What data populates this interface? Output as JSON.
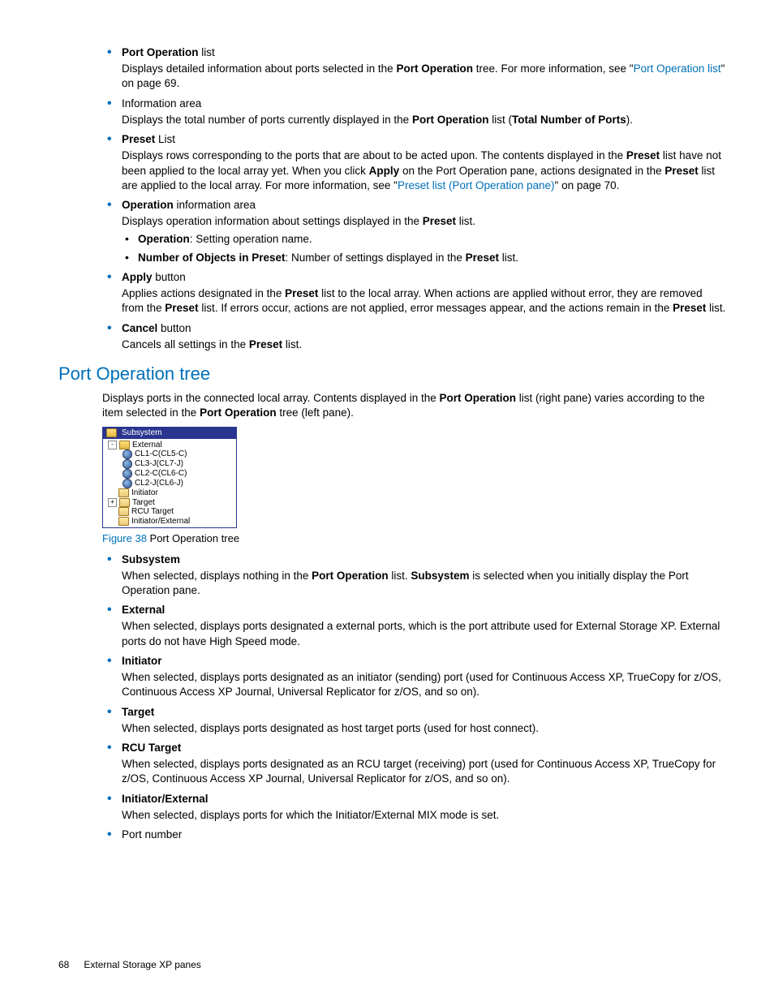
{
  "top_bullets": [
    {
      "title_segments": [
        {
          "t": "Port Operation",
          "b": true
        },
        {
          "t": " list",
          "b": false
        }
      ],
      "body_segments": [
        {
          "t": "Displays detailed information about ports selected in the ",
          "b": false
        },
        {
          "t": "Port Operation",
          "b": true
        },
        {
          "t": " tree. For more information, see \"",
          "b": false
        },
        {
          "t": "Port Operation list",
          "link": true
        },
        {
          "t": "\" on page 69.",
          "b": false
        }
      ]
    },
    {
      "title_segments": [
        {
          "t": "Information area",
          "b": false
        }
      ],
      "body_segments": [
        {
          "t": "Displays the total number of ports currently displayed in the ",
          "b": false
        },
        {
          "t": "Port Operation",
          "b": true
        },
        {
          "t": " list (",
          "b": false
        },
        {
          "t": "Total Number of Ports",
          "b": true
        },
        {
          "t": ").",
          "b": false
        }
      ]
    },
    {
      "title_segments": [
        {
          "t": "Preset",
          "b": true
        },
        {
          "t": " List",
          "b": false
        }
      ],
      "body_segments": [
        {
          "t": "Displays rows corresponding to the ports that are about to be acted upon. The contents displayed in the ",
          "b": false
        },
        {
          "t": "Preset",
          "b": true
        },
        {
          "t": " list have not been applied to the local array yet. When you click ",
          "b": false
        },
        {
          "t": "Apply",
          "b": true
        },
        {
          "t": " on the Port Operation pane, actions designated in the ",
          "b": false
        },
        {
          "t": "Preset",
          "b": true
        },
        {
          "t": " list are applied to the local array. For more information, see \"",
          "b": false
        },
        {
          "t": "Preset list (Port Operation pane)",
          "link": true
        },
        {
          "t": "\" on page 70.",
          "b": false
        }
      ]
    },
    {
      "title_segments": [
        {
          "t": "Operation",
          "b": true
        },
        {
          "t": " information area",
          "b": false
        }
      ],
      "body_segments": [
        {
          "t": "Displays operation information about settings displayed in the ",
          "b": false
        },
        {
          "t": "Preset",
          "b": true
        },
        {
          "t": " list.",
          "b": false
        }
      ],
      "sub": [
        [
          {
            "t": "Operation",
            "b": true
          },
          {
            "t": ": Setting operation name.",
            "b": false
          }
        ],
        [
          {
            "t": "Number of Objects in Preset",
            "b": true
          },
          {
            "t": ": Number of settings displayed in the ",
            "b": false
          },
          {
            "t": "Preset",
            "b": true
          },
          {
            "t": " list.",
            "b": false
          }
        ]
      ]
    },
    {
      "title_segments": [
        {
          "t": "Apply",
          "b": true
        },
        {
          "t": " button",
          "b": false
        }
      ],
      "body_segments": [
        {
          "t": "Applies actions designated in the ",
          "b": false
        },
        {
          "t": "Preset",
          "b": true
        },
        {
          "t": " list to the local array. When actions are applied without error, they are removed from the ",
          "b": false
        },
        {
          "t": "Preset",
          "b": true
        },
        {
          "t": " list. If errors occur, actions are not applied, error messages appear, and the actions remain in the ",
          "b": false
        },
        {
          "t": "Preset",
          "b": true
        },
        {
          "t": " list.",
          "b": false
        }
      ]
    },
    {
      "title_segments": [
        {
          "t": "Cancel",
          "b": true
        },
        {
          "t": " button",
          "b": false
        }
      ],
      "body_segments": [
        {
          "t": "Cancels all settings in the ",
          "b": false
        },
        {
          "t": "Preset",
          "b": true
        },
        {
          "t": " list.",
          "b": false
        }
      ]
    }
  ],
  "section_heading": "Port Operation tree",
  "section_intro_segments": [
    {
      "t": "Displays ports in the connected local array. Contents displayed in the ",
      "b": false
    },
    {
      "t": "Port Operation",
      "b": true
    },
    {
      "t": " list (right pane) varies according to the item selected in the ",
      "b": false
    },
    {
      "t": "Port Operation",
      "b": true
    },
    {
      "t": " tree (left pane).",
      "b": false
    }
  ],
  "figure": {
    "root": "Subsystem",
    "nodes": [
      {
        "depth": 1,
        "exp": "-",
        "icon": "folder-open",
        "label": "External"
      },
      {
        "depth": 2,
        "icon": "disk",
        "label": "CL1-C(CL5-C)"
      },
      {
        "depth": 2,
        "icon": "disk",
        "label": "CL3-J(CL7-J)"
      },
      {
        "depth": 2,
        "icon": "disk",
        "label": "CL2-C(CL6-C)"
      },
      {
        "depth": 2,
        "icon": "disk",
        "label": "CL2-J(CL6-J)"
      },
      {
        "depth": 1,
        "icon": "folder-closed",
        "label": "Initiator"
      },
      {
        "depth": 1,
        "exp": "+",
        "icon": "folder-closed",
        "label": "Target"
      },
      {
        "depth": 1,
        "icon": "folder-closed",
        "label": "RCU Target"
      },
      {
        "depth": 1,
        "icon": "folder-closed",
        "label": "Initiator/External"
      }
    ],
    "caption_label": "Figure 38",
    "caption_text": " Port Operation tree"
  },
  "tree_bullets": [
    {
      "title_segments": [
        {
          "t": "Subsystem",
          "b": true
        }
      ],
      "body_segments": [
        {
          "t": "When selected, displays nothing in the ",
          "b": false
        },
        {
          "t": "Port Operation",
          "b": true
        },
        {
          "t": " list. ",
          "b": false
        },
        {
          "t": "Subsystem",
          "b": true
        },
        {
          "t": " is selected when you initially display the Port Operation pane.",
          "b": false
        }
      ]
    },
    {
      "title_segments": [
        {
          "t": "External",
          "b": true
        }
      ],
      "body_segments": [
        {
          "t": "When selected, displays ports designated a external ports, which is the port attribute used for External Storage XP. External ports do not have High Speed mode.",
          "b": false
        }
      ]
    },
    {
      "title_segments": [
        {
          "t": "Initiator",
          "b": true
        }
      ],
      "body_segments": [
        {
          "t": "When selected, displays ports designated as an initiator (sending) port (used for Continuous Access XP, TrueCopy for z/OS, Continuous Access XP Journal, Universal Replicator for z/OS, and so on).",
          "b": false
        }
      ]
    },
    {
      "title_segments": [
        {
          "t": "Target",
          "b": true
        }
      ],
      "body_segments": [
        {
          "t": "When selected, displays ports designated as host target ports (used for host connect).",
          "b": false
        }
      ]
    },
    {
      "title_segments": [
        {
          "t": "RCU Target",
          "b": true
        }
      ],
      "body_segments": [
        {
          "t": "When selected, displays ports designated as an RCU target (receiving) port (used for Continuous Access XP, TrueCopy for z/OS, Continuous Access XP Journal, Universal Replicator for z/OS, and so on).",
          "b": false
        }
      ]
    },
    {
      "title_segments": [
        {
          "t": "Initiator/External",
          "b": true
        }
      ],
      "body_segments": [
        {
          "t": "When selected, displays ports for which the Initiator/External MIX mode is set.",
          "b": false
        }
      ]
    },
    {
      "title_segments": [
        {
          "t": "Port number",
          "b": false
        }
      ]
    }
  ],
  "footer": {
    "page": "68",
    "title": "External Storage XP panes"
  }
}
